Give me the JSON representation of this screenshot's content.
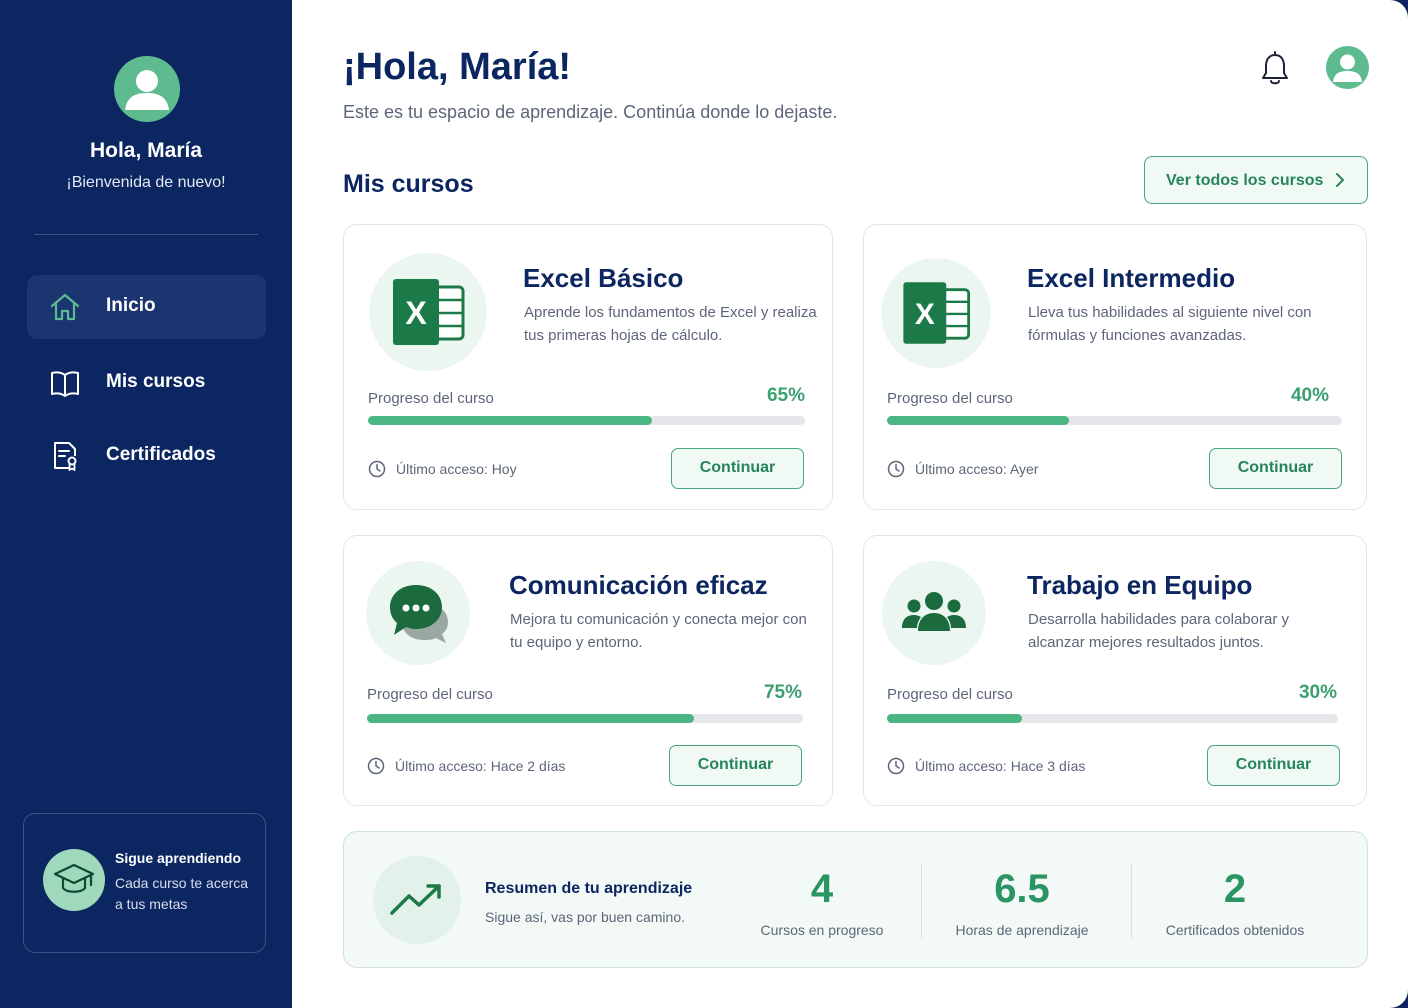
{
  "sidebar": {
    "name": "Hola, María",
    "welcome": "¡Bienvenida de nuevo!",
    "nav": [
      {
        "label": "Inicio",
        "icon": "home-icon",
        "active": true
      },
      {
        "label": "Mis cursos",
        "icon": "book-icon",
        "active": false
      },
      {
        "label": "Certificados",
        "icon": "certificate-icon",
        "active": false
      }
    ],
    "promo": {
      "title": "Sigue aprendiendo",
      "text": "Cada curso te acerca a tus metas",
      "icon": "graduation-cap-icon"
    }
  },
  "header": {
    "greeting": "¡Hola, María!",
    "subtitle": "Este es tu espacio de aprendizaje. Continúa donde lo dejaste.",
    "icons": [
      "bell-icon",
      "user-avatar"
    ]
  },
  "courses_section": {
    "title": "Mis cursos",
    "view_all": "Ver todos los cursos"
  },
  "courses": [
    {
      "title": "Excel Básico",
      "description": "Aprende los fundamentos de Excel y realiza tus primeras hojas de cálculo.",
      "icon": "excel-icon",
      "progress_label": "Progreso del curso",
      "progress_text": "65%",
      "progress": 0.65,
      "last_access": "Último acceso: Hoy",
      "button": "Continuar"
    },
    {
      "title": "Excel Intermedio",
      "description": "Lleva tus habilidades al siguiente nivel con fórmulas y funciones avanzadas.",
      "icon": "excel-icon",
      "progress_label": "Progreso del curso",
      "progress_text": "40%",
      "progress": 0.4,
      "last_access": "Último acceso: Ayer",
      "button": "Continuar"
    },
    {
      "title": "Comunicación eficaz",
      "description": "Mejora tu comunicación y conecta mejor con tu equipo y entorno.",
      "icon": "chat-bubbles-icon",
      "progress_label": "Progreso del curso",
      "progress_text": "75%",
      "progress": 0.75,
      "last_access": "Último acceso: Hace 2 días",
      "button": "Continuar"
    },
    {
      "title": "Trabajo en Equipo",
      "description": "Desarrolla habilidades para colaborar y alcanzar mejores resultados juntos.",
      "icon": "team-icon",
      "progress_label": "Progreso del curso",
      "progress_text": "30%",
      "progress": 0.3,
      "last_access": "Último acceso: Hace 3 días",
      "button": "Continuar"
    }
  ],
  "summary": {
    "title": "Resumen de tu aprendizaje",
    "subtitle": "Sigue así, vas por buen camino.",
    "icon": "trending-up-icon",
    "stats": [
      {
        "value": "4",
        "label": "Cursos en progreso"
      },
      {
        "value": "6.5",
        "label": "Horas de aprendizaje"
      },
      {
        "value": "2",
        "label": "Certificados obtenidos"
      }
    ]
  },
  "colors": {
    "sidebar_bg": "#0b2660",
    "accent_green": "#4cb584",
    "title_navy": "#0b2660"
  }
}
